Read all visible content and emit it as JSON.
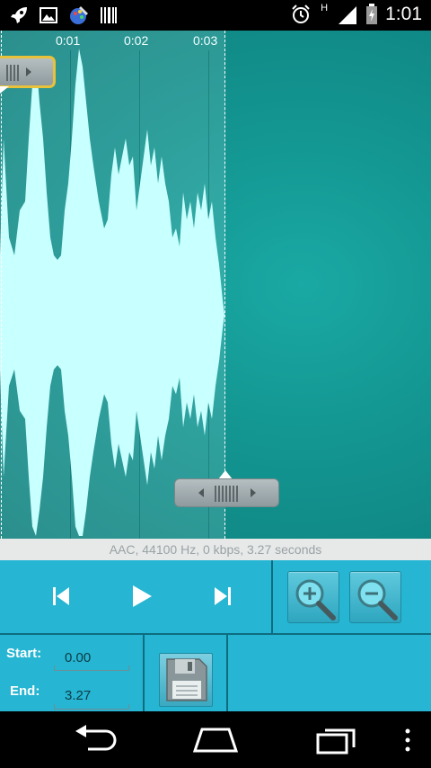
{
  "status_bar": {
    "time": "1:01",
    "network_label": "H",
    "left_icons": [
      "rocket-icon",
      "picture-icon",
      "paint-icon",
      "barcode-icon"
    ],
    "right_icons": [
      "alarm-icon",
      "signal-icon",
      "battery-icon"
    ]
  },
  "waveform": {
    "time_marks": [
      "0:01",
      "0:02",
      "0:03"
    ],
    "waveform_color": "#c8ffff",
    "background_color": "#139591"
  },
  "info": {
    "text": "AAC, 44100 Hz, 0 kbps, 3.27 seconds"
  },
  "controls": {
    "background_color": "#26b5d2",
    "start_label": "Start:",
    "start_value": "0.00",
    "end_label": "End:",
    "end_value": "3.27"
  }
}
